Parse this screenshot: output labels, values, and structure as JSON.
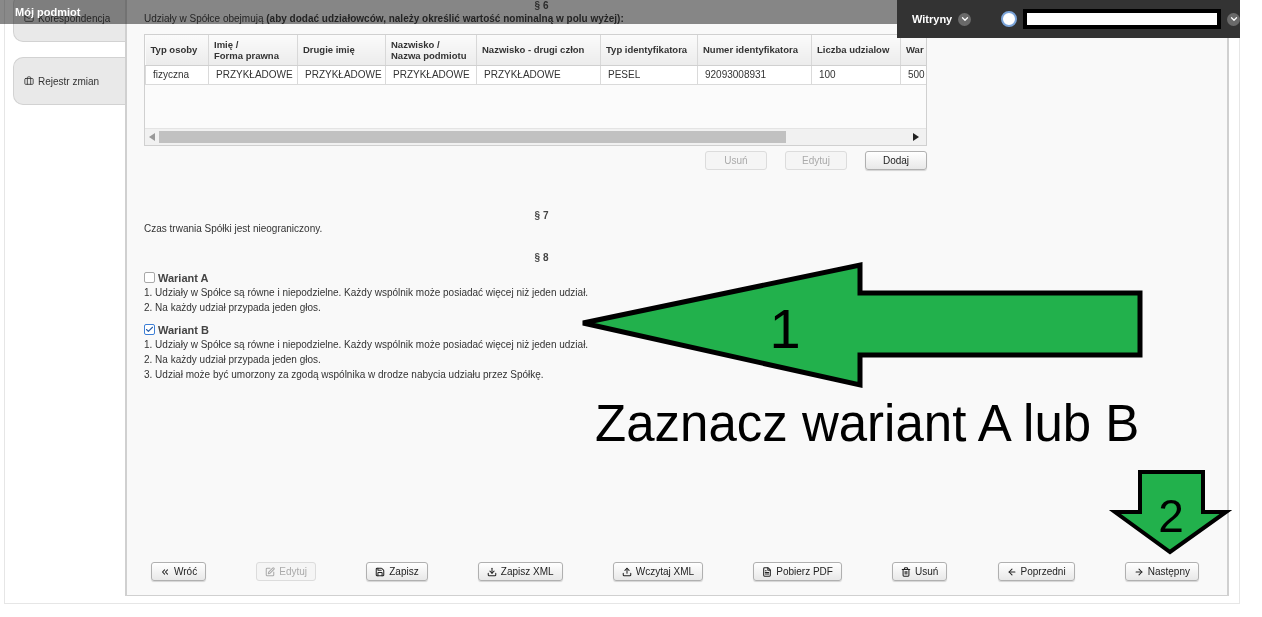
{
  "header": {
    "title": "Mój podmiot",
    "sites_menu": "Witryny"
  },
  "sidebar": {
    "tabs": [
      {
        "label": "Korespondencja"
      },
      {
        "label": "Rejestr zmian"
      }
    ]
  },
  "section_6": {
    "heading": "§ 6",
    "intro": "Udziały w Spółce obejmują **(aby dodać udziałowców, należy określić wartość nominalną w polu wyżej):**",
    "table": {
      "columns": [
        "Typ osoby",
        "Imię /\nForma prawna",
        "Drugie imię",
        "Nazwisko /\nNazwa podmiotu",
        "Nazwisko - drugi człon",
        "Typ identyfikatora",
        "Numer identyfikatora",
        "Liczba udzialow",
        "War"
      ],
      "rows": [
        [
          "fizyczna",
          "PRZYKŁADOWE",
          "PRZYKŁADOWE",
          "PRZYKŁADOWE",
          "PRZYKŁADOWE",
          "PESEL",
          "92093008931",
          "100",
          "500"
        ]
      ]
    },
    "buttons": [
      {
        "label": "Usuń",
        "disabled": true
      },
      {
        "label": "Edytuj",
        "disabled": true
      },
      {
        "label": "Dodaj",
        "disabled": false
      }
    ]
  },
  "section_7": {
    "heading": "§ 7",
    "text": "Czas trwania Spółki jest nieograniczony."
  },
  "section_8": {
    "heading": "§ 8",
    "variants": [
      {
        "label": "Wariant A",
        "checked": false,
        "lines": [
          "1. Udziały w Spółce są równe i niepodzielne. Każdy wspólnik może posiadać więcej niż jeden udział.",
          "2. Na każdy udział przypada jeden głos."
        ]
      },
      {
        "label": "Wariant B",
        "checked": true,
        "lines": [
          "1. Udziały w Spółce są równe i niepodzielne. Każdy wspólnik może posiadać więcej niż jeden udział.",
          "2. Na każdy udział przypada jeden głos.",
          "3. Udział może być umorzony za zgodą wspólnika w drodze nabycia udziału przez Spółkę."
        ]
      }
    ]
  },
  "footer_buttons": [
    {
      "label": "Wróć",
      "disabled": false
    },
    {
      "label": "Edytuj",
      "disabled": true
    },
    {
      "label": "Zapisz",
      "disabled": false
    },
    {
      "label": "Zapisz XML",
      "disabled": false
    },
    {
      "label": "Wczytaj XML",
      "disabled": false
    },
    {
      "label": "Pobierz PDF",
      "disabled": false
    },
    {
      "label": "Usuń",
      "disabled": false
    },
    {
      "label": "Poprzedni",
      "disabled": false
    },
    {
      "label": "Następny",
      "disabled": false
    }
  ],
  "annotations": {
    "step_1": "1",
    "instruction": "Zaznacz wariant A lub B",
    "step_2": "2"
  }
}
